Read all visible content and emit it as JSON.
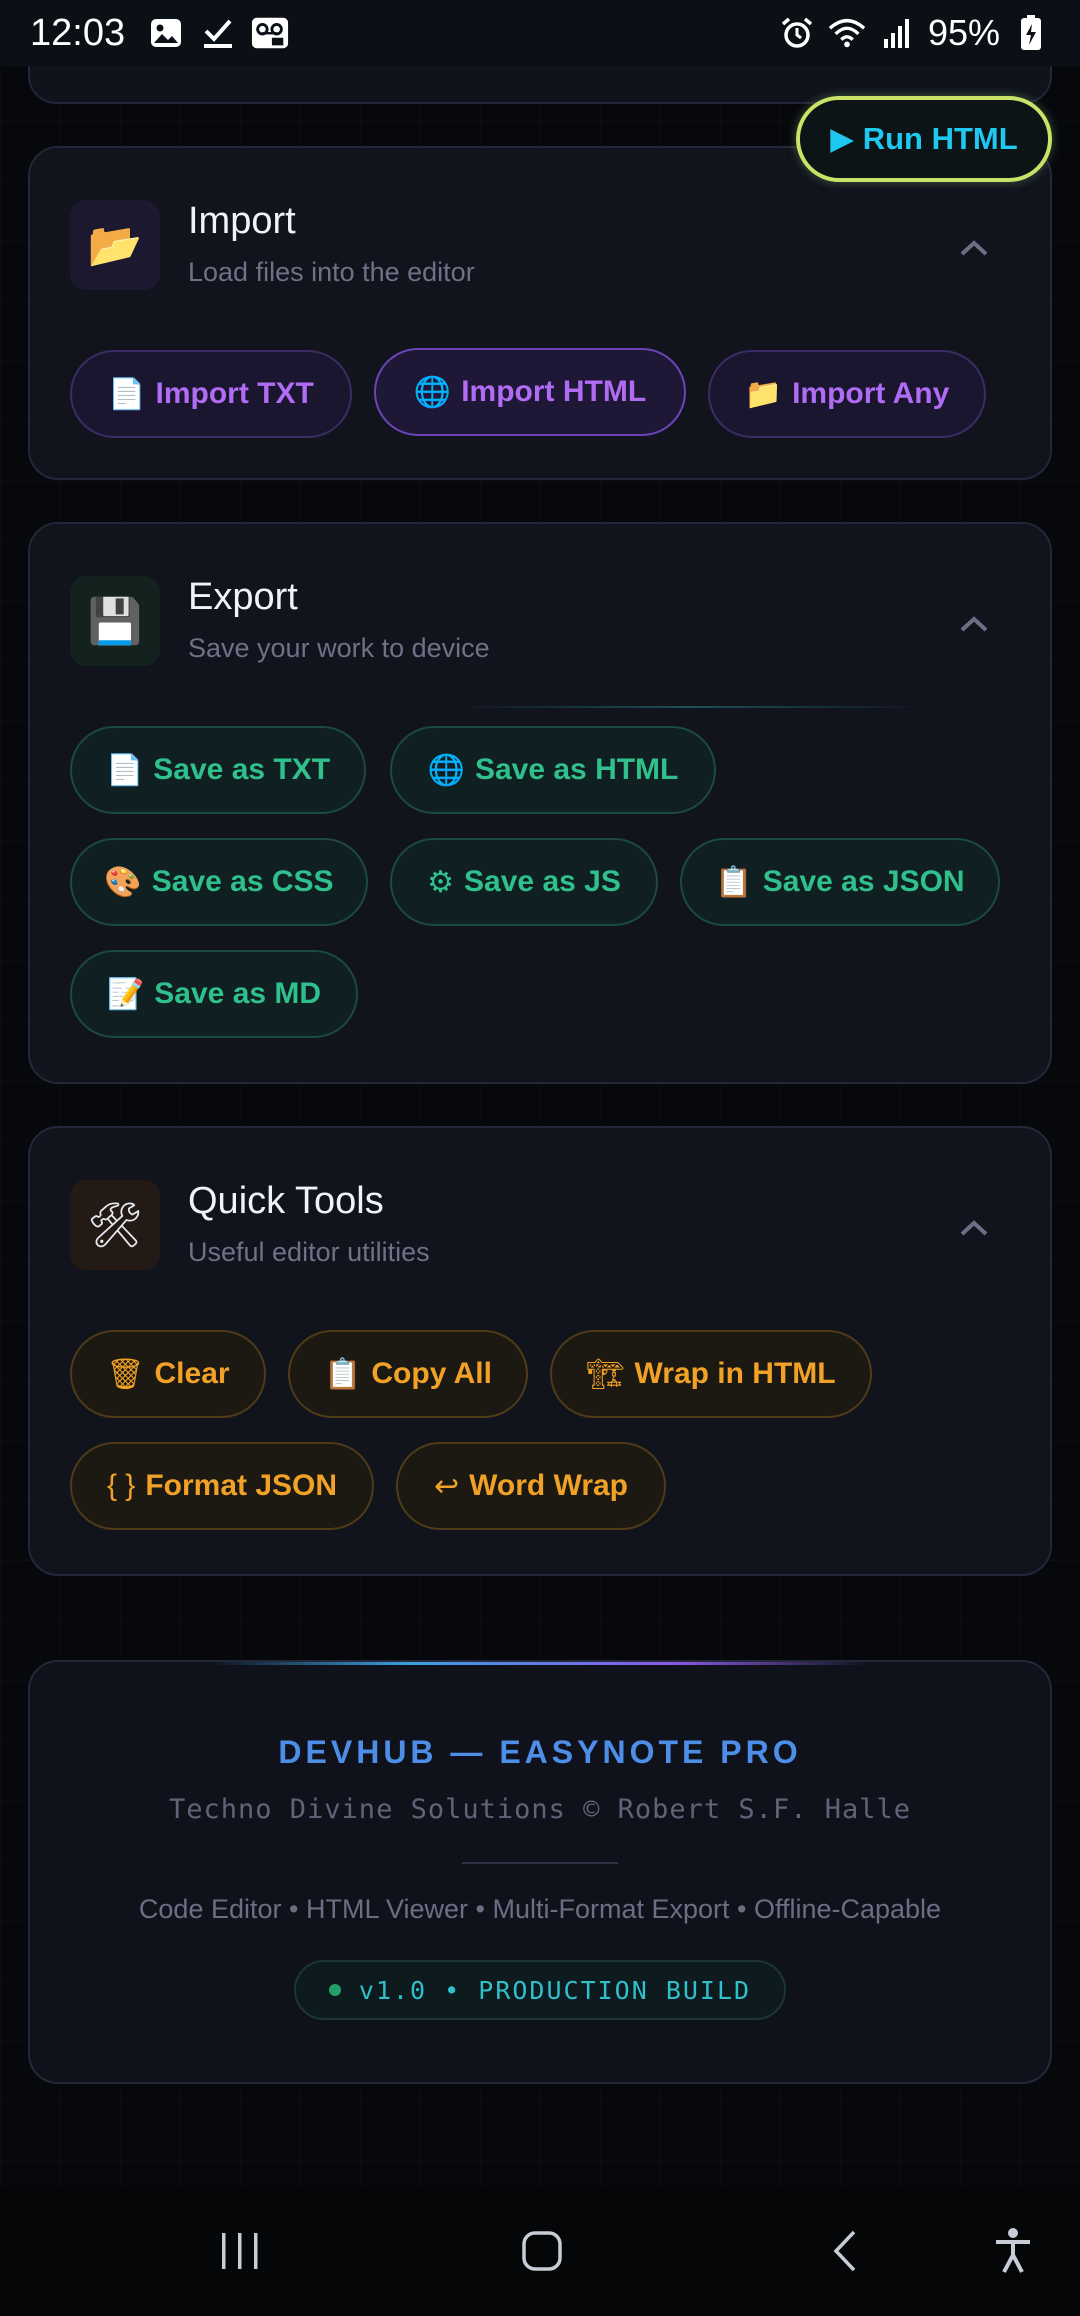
{
  "status_bar": {
    "time": "12:03",
    "battery": "95%",
    "left_icons": [
      "image-icon",
      "check-icon",
      "voicemail-icon"
    ],
    "right_icons": [
      "alarm-icon",
      "wifi-icon",
      "signal-icon",
      "battery-icon"
    ]
  },
  "run_button": {
    "label": "▶ Run HTML"
  },
  "import_card": {
    "icon": "📂",
    "title": "Import",
    "subtitle": "Load files into the editor",
    "buttons": [
      {
        "emoji": "📄",
        "label": "Import TXT"
      },
      {
        "emoji": "🌐",
        "label": "Import HTML"
      },
      {
        "emoji": "📁",
        "label": "Import Any"
      }
    ]
  },
  "export_card": {
    "icon": "💾",
    "title": "Export",
    "subtitle": "Save your work to device",
    "buttons": [
      {
        "emoji": "📄",
        "label": "Save as TXT"
      },
      {
        "emoji": "🌐",
        "label": "Save as HTML"
      },
      {
        "emoji": "🎨",
        "label": "Save as CSS"
      },
      {
        "emoji": "⚙",
        "label": "Save as JS"
      },
      {
        "emoji": "📋",
        "label": "Save as JSON"
      },
      {
        "emoji": "📝",
        "label": "Save as MD"
      }
    ]
  },
  "tools_card": {
    "icon": "🛠",
    "title": "Quick Tools",
    "subtitle": "Useful editor utilities",
    "buttons": [
      {
        "emoji": "🗑",
        "label": "Clear"
      },
      {
        "emoji": "📋",
        "label": "Copy All"
      },
      {
        "emoji": "🏗",
        "label": "Wrap in HTML"
      },
      {
        "emoji": "{ }",
        "label": "Format JSON"
      },
      {
        "emoji": "↩",
        "label": "Word Wrap"
      }
    ]
  },
  "footer": {
    "title": "DEVHUB — EASYNOTE PRO",
    "subtitle": "Techno Divine Solutions © Robert S.F. Halle",
    "features": "Code Editor • HTML Viewer • Multi-Format Export • Offline-Capable",
    "badge": "v1.0 • PRODUCTION BUILD"
  },
  "colors": {
    "import_accent": "#b06cf4",
    "export_accent": "#2fc08c",
    "tools_accent": "#f0a126",
    "run_accent": "#1ec8f0"
  }
}
